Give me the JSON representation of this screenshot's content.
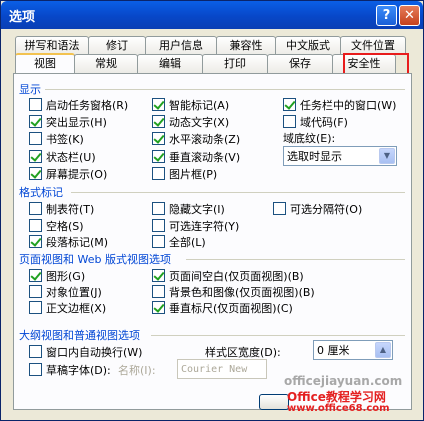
{
  "window": {
    "title": "选项",
    "help_label": "?",
    "close_label": "✕"
  },
  "tabs_back": [
    "拼写和语法",
    "修订",
    "用户信息",
    "兼容性",
    "中文版式",
    "文件位置"
  ],
  "tabs_front": [
    "视图",
    "常规",
    "编辑",
    "打印",
    "保存",
    "安全性"
  ],
  "active_tab": "视图",
  "highlighted_tab": "安全性",
  "display": {
    "label": "显示",
    "items": [
      {
        "label": "启动任务窗格(R)",
        "checked": false
      },
      {
        "label": "突出显示(H)",
        "checked": true
      },
      {
        "label": "书签(K)",
        "checked": false
      },
      {
        "label": "状态栏(U)",
        "checked": true
      },
      {
        "label": "屏幕提示(O)",
        "checked": true
      },
      {
        "label": "智能标记(A)",
        "checked": true
      },
      {
        "label": "动态文字(X)",
        "checked": true
      },
      {
        "label": "水平滚动条(Z)",
        "checked": true
      },
      {
        "label": "垂直滚动条(V)",
        "checked": true
      },
      {
        "label": "图片框(P)",
        "checked": false
      },
      {
        "label": "任务栏中的窗口(W)",
        "checked": true
      },
      {
        "label": "域代码(F)",
        "checked": false
      }
    ],
    "field_shading_label": "域底纹(E):",
    "field_shading_value": "选取时显示"
  },
  "format_marks": {
    "label": "格式标记",
    "items": [
      {
        "label": "制表符(T)",
        "checked": false
      },
      {
        "label": "空格(S)",
        "checked": false
      },
      {
        "label": "段落标记(M)",
        "checked": true
      },
      {
        "label": "隐藏文字(I)",
        "checked": false
      },
      {
        "label": "可选连字符(Y)",
        "checked": false
      },
      {
        "label": "全部(L)",
        "checked": false
      },
      {
        "label": "可选分隔符(O)",
        "checked": false
      }
    ]
  },
  "print_web_view": {
    "label": "页面视图和 Web 版式视图选项",
    "items": [
      {
        "label": "图形(G)",
        "checked": true
      },
      {
        "label": "对象位置(J)",
        "checked": false
      },
      {
        "label": "正文边框(X)",
        "checked": false
      },
      {
        "label": "页面间空白(仅页面视图)(B)",
        "checked": true
      },
      {
        "label": "背景色和图像(仅页面视图)(B)",
        "checked": false
      },
      {
        "label": "垂直标尺(仅页面视图)(C)",
        "checked": true
      }
    ]
  },
  "outline_normal": {
    "label": "大纲视图和普通视图选项",
    "wrap_label": "窗口内自动换行(W)",
    "draft_font_label": "草稿字体(D):",
    "name_label": "名称(I):",
    "name_value": "Courier New",
    "style_width_label": "样式区宽度(D):",
    "style_width_value": "0 厘米"
  },
  "watermark": {
    "line1": "officejiayuan.com",
    "line2": "Office教程学习网",
    "line3": "www.office68.com"
  }
}
